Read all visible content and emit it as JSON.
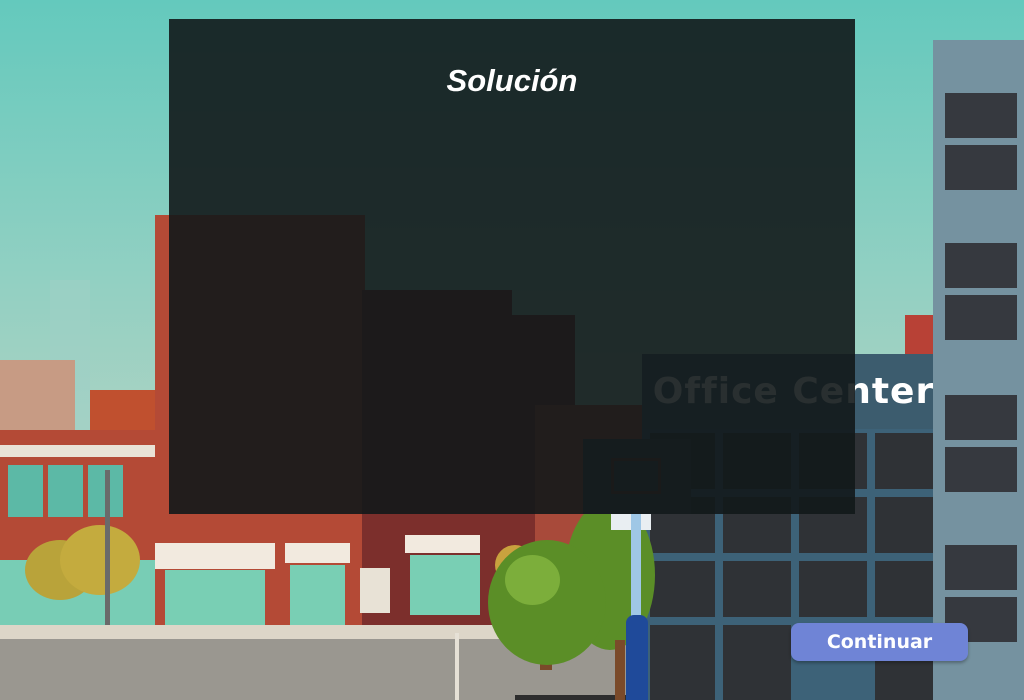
{
  "overlay": {
    "title": "Solución"
  },
  "scene": {
    "office_sign": "Office Center"
  },
  "actions": {
    "continue_label": "Continuar"
  }
}
